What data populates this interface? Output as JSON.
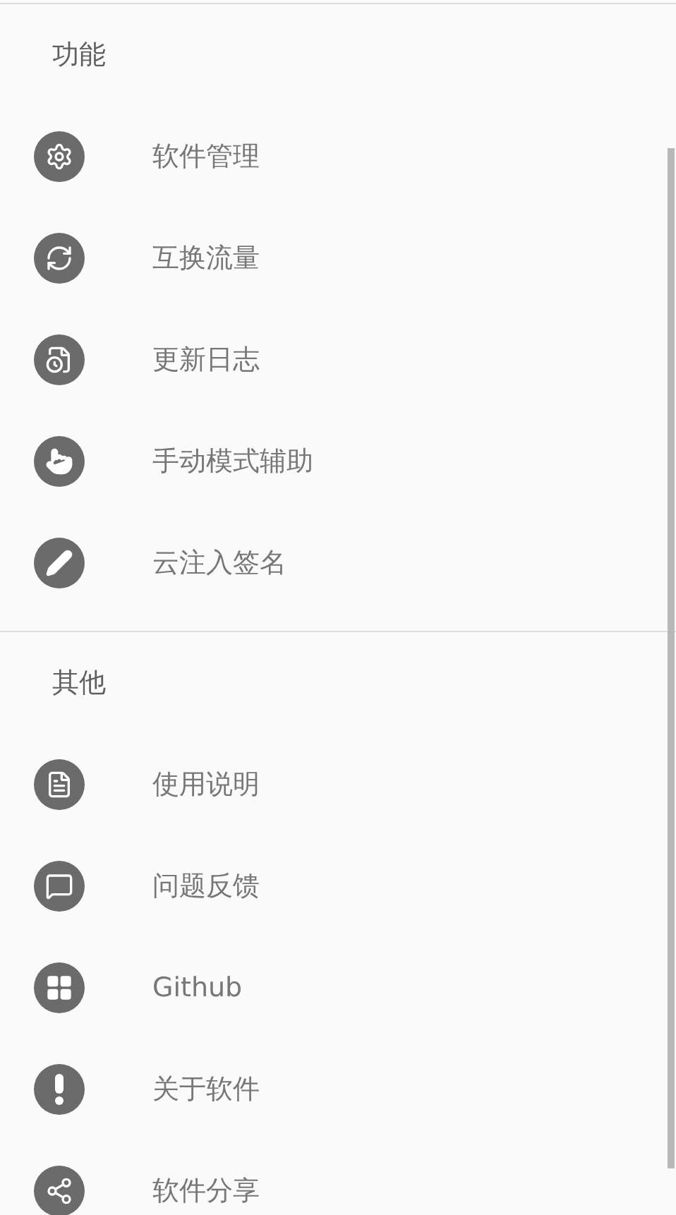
{
  "sections": [
    {
      "title": "功能",
      "items": [
        {
          "label": "软件管理"
        },
        {
          "label": "互换流量"
        },
        {
          "label": "更新日志"
        },
        {
          "label": "手动模式辅助"
        },
        {
          "label": "云注入签名"
        }
      ]
    },
    {
      "title": "其他",
      "items": [
        {
          "label": "使用说明"
        },
        {
          "label": "问题反馈"
        },
        {
          "label": "Github"
        },
        {
          "label": "关于软件"
        },
        {
          "label": "软件分享"
        }
      ]
    }
  ]
}
